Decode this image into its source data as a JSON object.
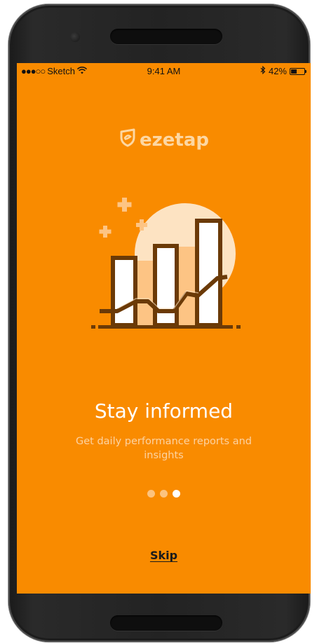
{
  "status_bar": {
    "carrier": "Sketch",
    "time": "9:41 AM",
    "battery": "42%",
    "battery_level": 0.42,
    "signal_dots": "●●●○○"
  },
  "brand": {
    "name": "ezetap",
    "logo_color": "#fdd7a2"
  },
  "onboarding": {
    "title": "Stay informed",
    "description": "Get daily performance reports and insights",
    "page_count": 3,
    "active_page": 3,
    "skip_label": "Skip"
  },
  "colors": {
    "background": "#f98b00",
    "chart_outline": "#6b3a07",
    "bar_fill": "#ffffff",
    "circle": "#fde3c2",
    "accent_light": "#fdc484"
  },
  "icons": {
    "wifi": "wifi-icon",
    "bluetooth": "bluetooth-icon",
    "battery": "battery-icon",
    "logo": "ezetap-logo-icon",
    "illustration": "bar-chart-illustration"
  }
}
